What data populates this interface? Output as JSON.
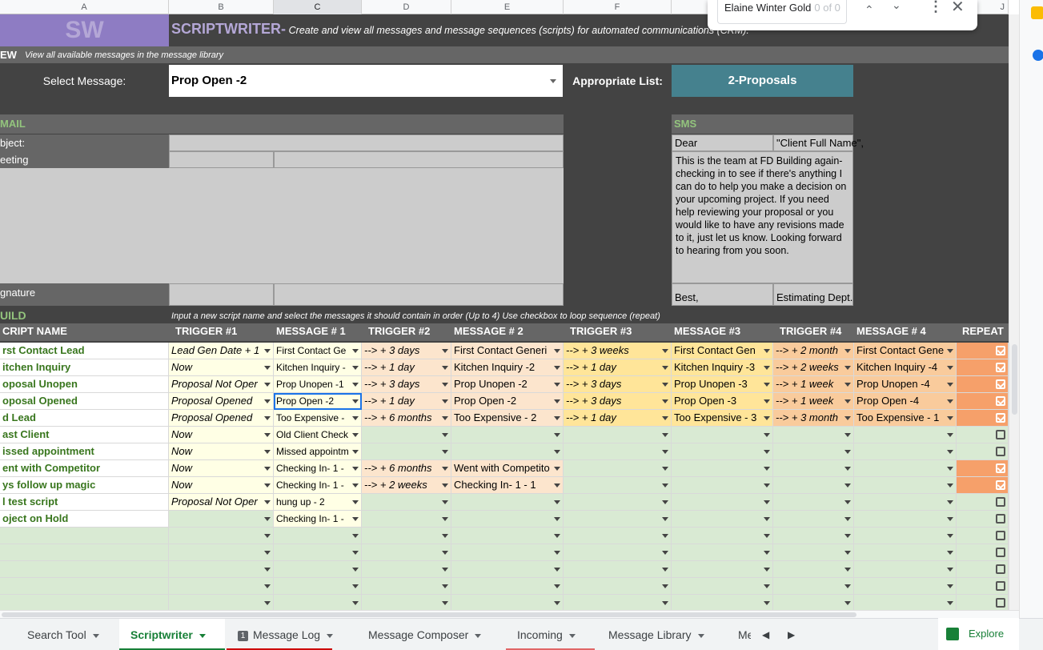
{
  "columns": [
    "A",
    "B",
    "C",
    "D",
    "E",
    "F",
    "",
    "",
    "J"
  ],
  "header": {
    "logo": "SW",
    "title": "SCRIPTWRITER-",
    "subtitle": "Create and view all messages and message sequences (scripts) for automated communications (CRM)."
  },
  "view_band": {
    "label": "EW",
    "sub": "View all available messages in the message library"
  },
  "select": {
    "label": "Select Message:",
    "value": "Prop Open -2",
    "list_label": "Appropriate List:",
    "list_value": "2-Proposals"
  },
  "email": {
    "header": "MAIL",
    "subject": "bject:",
    "greeting": "eeting",
    "signature": "gnature"
  },
  "sms": {
    "header": "SMS",
    "dear": "Dear",
    "client": "\"Client Full Name\",",
    "body": "This is the team at FD Building again- checking in to see if there's anything I can do to help you make a decision on your upcoming project. If you need help reviewing your proposal or you would like to have any revisions made to it, just let us know. Looking forward to hearing from you soon.",
    "closing": "Best,",
    "sender": "Estimating Dept."
  },
  "build": {
    "header": "UILD",
    "instructions": "Input a new script name and select the messages it should contain in order (Up to 4) Use  checkbox to loop sequence (repeat)",
    "columns": [
      "CRIPT NAME",
      "TRIGGER #1",
      "MESSAGE # 1",
      "TRIGGER #2",
      "MESSAGE # 2",
      "TRIGGER #3",
      "MESSAGE #3",
      "TRIGGER #4",
      "MESSAGE # 4",
      "REPEAT"
    ],
    "rows": [
      {
        "name": "rst Contact Lead",
        "t1": "Lead Gen Date + 1",
        "m1": "First Contact Ge",
        "t2": "--> + 3 days",
        "m2": "First Contact Generi",
        "t3": "--> + 3 weeks",
        "m3": "First Contact Gen",
        "t4": "--> + 2 month",
        "m4": "First Contact Gene",
        "repeat": true
      },
      {
        "name": "itchen Inquiry",
        "t1": "Now",
        "m1": "Kitchen Inquiry -",
        "t2": "--> + 1 day",
        "m2": "Kitchen Inquiry -2",
        "t3": "--> + 1 day",
        "m3": "Kitchen Inquiry -3",
        "t4": "--> + 2 weeks",
        "m4": "Kitchen Inquiry -4",
        "repeat": true
      },
      {
        "name": "oposal Unopen",
        "t1": "Proposal Not Oper",
        "m1": "Prop Unopen -1",
        "t2": "--> + 3 days",
        "m2": "Prop Unopen -2",
        "t3": "--> + 3 days",
        "m3": "Prop Unopen -3",
        "t4": "--> + 1 week",
        "m4": "Prop Unopen -4",
        "repeat": true
      },
      {
        "name": "oposal Opened",
        "t1": "Proposal Opened",
        "m1": "Prop Open -2",
        "t2": "--> + 1 day",
        "m2": "Prop Open -2",
        "t3": "--> + 3 days",
        "m3": "Prop Open -3",
        "t4": "--> + 1 week",
        "m4": "Prop Open -4",
        "repeat": true
      },
      {
        "name": "d Lead",
        "t1": "Proposal Opened",
        "m1": "Too Expensive -",
        "t2": "--> + 6 months",
        "m2": "Too Expensive - 2",
        "t3": "--> + 1 day",
        "m3": "Too Expensive - 3",
        "t4": "--> + 3 month",
        "m4": "Too Expensive - 1",
        "repeat": true
      },
      {
        "name": "ast Client",
        "t1": "Now",
        "m1": "Old Client Check",
        "t2": "",
        "m2": "",
        "t3": "",
        "m3": "",
        "t4": "",
        "m4": "",
        "repeat": false
      },
      {
        "name": "issed appointment",
        "t1": "Now",
        "m1": "Missed appointm",
        "t2": "",
        "m2": "",
        "t3": "",
        "m3": "",
        "t4": "",
        "m4": "",
        "repeat": false
      },
      {
        "name": "ent with Competitor",
        "t1": "Now",
        "m1": "Checking In- 1 -",
        "t2": "--> + 6 months",
        "m2": "Went with Competito",
        "t3": "",
        "m3": "",
        "t4": "",
        "m4": "",
        "repeat": true
      },
      {
        "name": "ys follow up magic",
        "t1": "Now",
        "m1": "Checking In- 1 -",
        "t2": "--> + 2 weeks",
        "m2": "Checking In- 1 - 1",
        "t3": "",
        "m3": "",
        "t4": "",
        "m4": "",
        "repeat": true
      },
      {
        "name": "l test script",
        "t1": "Proposal Not Oper",
        "m1": "hung up - 2",
        "t2": "",
        "m2": "",
        "t3": "",
        "m3": "",
        "t4": "",
        "m4": "",
        "repeat": false
      },
      {
        "name": "oject on Hold",
        "t1": "",
        "m1": "Checking In- 1 -",
        "t2": "",
        "m2": "",
        "t3": "",
        "m3": "",
        "t4": "",
        "m4": "",
        "repeat": false
      },
      {
        "name": "",
        "t1": "",
        "m1": "",
        "t2": "",
        "m2": "",
        "t3": "",
        "m3": "",
        "t4": "",
        "m4": "",
        "repeat": false
      },
      {
        "name": "",
        "t1": "",
        "m1": "",
        "t2": "",
        "m2": "",
        "t3": "",
        "m3": "",
        "t4": "",
        "m4": "",
        "repeat": false
      },
      {
        "name": "",
        "t1": "",
        "m1": "",
        "t2": "",
        "m2": "",
        "t3": "",
        "m3": "",
        "t4": "",
        "m4": "",
        "repeat": false
      },
      {
        "name": "",
        "t1": "",
        "m1": "",
        "t2": "",
        "m2": "",
        "t3": "",
        "m3": "",
        "t4": "",
        "m4": "",
        "repeat": false
      },
      {
        "name": "",
        "t1": "",
        "m1": "",
        "t2": "",
        "m2": "",
        "t3": "",
        "m3": "",
        "t4": "",
        "m4": "",
        "repeat": false
      }
    ]
  },
  "find": {
    "query": "Elaine Winter Gold",
    "count": "0 of 0"
  },
  "tabs": [
    {
      "label": "Search Tool",
      "active": false,
      "color": ""
    },
    {
      "label": "Scriptwriter",
      "active": true,
      "color": "#188038"
    },
    {
      "label": "Message Log",
      "active": false,
      "color": "#cc0000",
      "badge": "1"
    },
    {
      "label": "Message Composer",
      "active": false,
      "color": ""
    },
    {
      "label": "Incoming",
      "active": false,
      "color": "#e06666"
    },
    {
      "label": "Message Library",
      "active": false,
      "color": ""
    },
    {
      "label": "Me",
      "active": false,
      "color": ""
    }
  ],
  "explore_label": "Explore",
  "colors": {
    "purple": "#8e7cc3",
    "teal": "#45818e",
    "green_text": "#38761d",
    "green_bg": "#d9ead3",
    "repeat_bg": "#f6a06a"
  }
}
